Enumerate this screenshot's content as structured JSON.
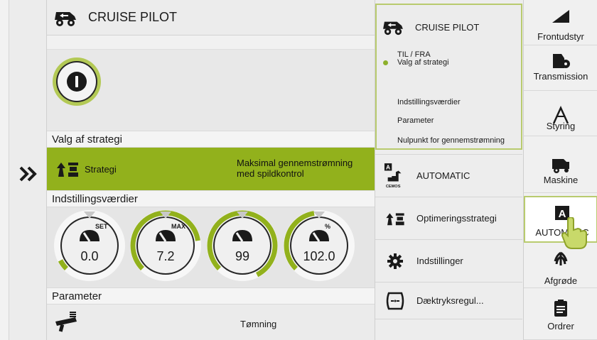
{
  "main": {
    "header_title": "CRUISE PILOT",
    "power_label": "I",
    "section_strategy": "Valg af strategi",
    "strategy_label": "Strategi",
    "strategy_value_line1": "Maksimal gennemstrømning",
    "strategy_value_line2": "med spildkontrol",
    "section_settings": "Indstillingsværdier",
    "gauges": [
      {
        "tag": "SET",
        "value": "0.0",
        "fill": 0.05
      },
      {
        "tag": "MAX",
        "value": "7.2",
        "fill": 0.6
      },
      {
        "tag": "",
        "value": "99",
        "fill": 0.8
      },
      {
        "tag": "%",
        "value": "102.0",
        "fill": 0.35
      }
    ],
    "section_param": "Parameter",
    "param_label": "Tømning"
  },
  "menu": {
    "sub_title": "CRUISE PILOT",
    "sub_items": [
      "TIL / FRA",
      "Valg af strategi",
      "Indstillingsværdier",
      "Parameter",
      "Nulpunkt for gennemstrømning"
    ],
    "automatic_label": "AUTOMATIC",
    "automatic_badge": "A",
    "automatic_sub": "CEMOS",
    "optimering_label": "Optimeringsstrategi",
    "indstillinger_label": "Indstillinger",
    "daek_label": "Dæktryksregul..."
  },
  "rbar": {
    "items": [
      "Frontudstyr",
      "Transmission",
      "Styring",
      "Maskine",
      "AUTOMATIC",
      "Afgrøde",
      "Ordrer"
    ],
    "automatic_badge": "A"
  },
  "colors": {
    "accent": "#92b11c",
    "outline": "#b9cb6e"
  }
}
